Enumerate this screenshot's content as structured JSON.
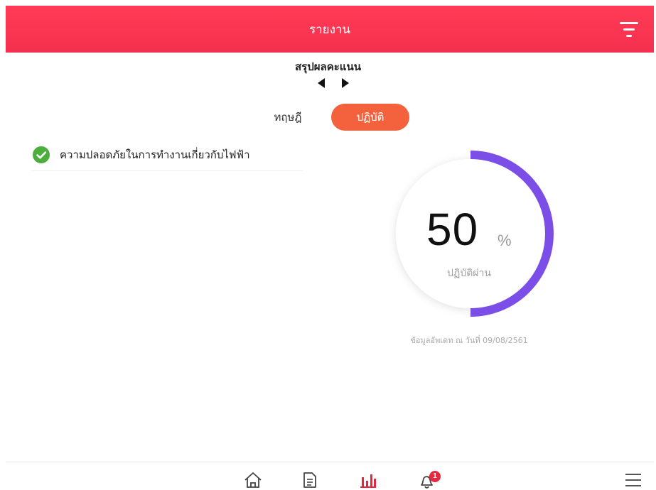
{
  "header": {
    "title": "รายงาน",
    "filter_icon": "filter-icon"
  },
  "summary": {
    "title": "สรุปผลคะแนน",
    "prev_icon": "caret-left-icon",
    "next_icon": "caret-right-icon"
  },
  "tabs": [
    {
      "label": "ทฤษฎี",
      "active": false
    },
    {
      "label": "ปฏิบัติ",
      "active": true
    }
  ],
  "items": [
    {
      "label": "ความปลอดภัยในการทำงานเกี่ยวกับไฟฟ้า",
      "status": "passed",
      "icon": "check-circle-icon"
    }
  ],
  "gauge": {
    "value": "50",
    "unit": "%",
    "label": "ปฏิบัติผ่าน",
    "fraction": 0.5
  },
  "update_note": "ข้อมูลอัพเดท ณ วันที่ 09/08/2561",
  "bottom_nav": {
    "items": [
      "home-icon",
      "document-icon",
      "chart-icon",
      "bell-icon"
    ],
    "active": "chart-icon",
    "notification_count": "1",
    "menu_icon": "hamburger-menu-icon"
  },
  "colors": {
    "header": "#f4304f",
    "active_tab": "#f4623d",
    "gauge_progress": "#7b4ee8",
    "check": "#4cae3c",
    "nav_active": "#e8263d"
  }
}
